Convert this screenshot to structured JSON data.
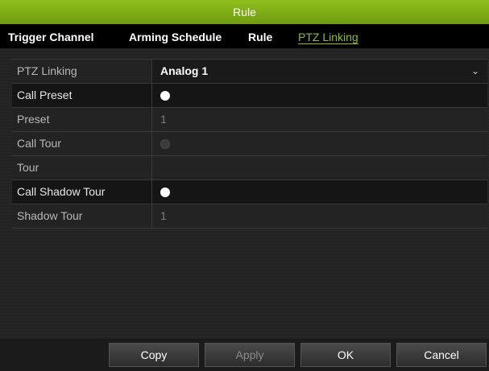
{
  "window": {
    "title": "Rule"
  },
  "tabs": [
    {
      "label": "Trigger Channel",
      "active": false
    },
    {
      "label": "Arming Schedule",
      "active": false
    },
    {
      "label": "Rule",
      "active": false
    },
    {
      "label": "PTZ Linking",
      "active": true
    }
  ],
  "form": {
    "ptz_linking": {
      "label": "PTZ Linking",
      "value": "Analog 1"
    },
    "call_preset": {
      "label": "Call Preset",
      "checked": true
    },
    "preset": {
      "label": "Preset",
      "value": "1"
    },
    "call_tour": {
      "label": "Call Tour",
      "checked": false
    },
    "tour": {
      "label": "Tour",
      "value": ""
    },
    "call_shadow_tour": {
      "label": "Call Shadow Tour",
      "checked": true
    },
    "shadow_tour": {
      "label": "Shadow Tour",
      "value": "1"
    }
  },
  "buttons": {
    "copy": "Copy",
    "apply": "Apply",
    "ok": "OK",
    "cancel": "Cancel"
  },
  "colors": {
    "accent": "#8fbf1e"
  }
}
